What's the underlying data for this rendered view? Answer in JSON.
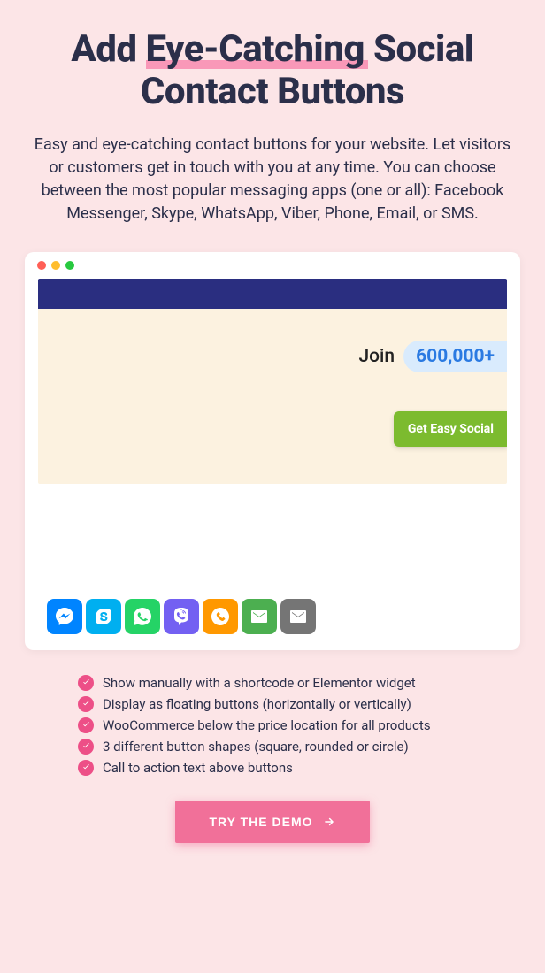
{
  "heading": {
    "pre": "Add ",
    "highlight": "Eye-Catching",
    "post": " Social Contact Buttons"
  },
  "subtitle": "Easy and eye-catching contact buttons for your website. Let visitors or customers get in touch with you at any time. You can choose between the most popular messaging apps (one or all): Facebook Messenger, Skype, WhatsApp, Viber, Phone, Email, or SMS.",
  "preview": {
    "join_label": "Join",
    "pill_value": "600,000+",
    "green_button": "Get Easy Social"
  },
  "social_icons": [
    "messenger",
    "skype",
    "whatsapp",
    "viber",
    "phone",
    "email",
    "sms"
  ],
  "features": [
    "Show manually with a shortcode or Elementor widget",
    "Display as floating buttons (horizontally or vertically)",
    "WooCommerce below the price location for all products",
    "3 different button shapes (square, rounded or circle)",
    "Call to action text above buttons"
  ],
  "cta_label": "TRY THE DEMO"
}
